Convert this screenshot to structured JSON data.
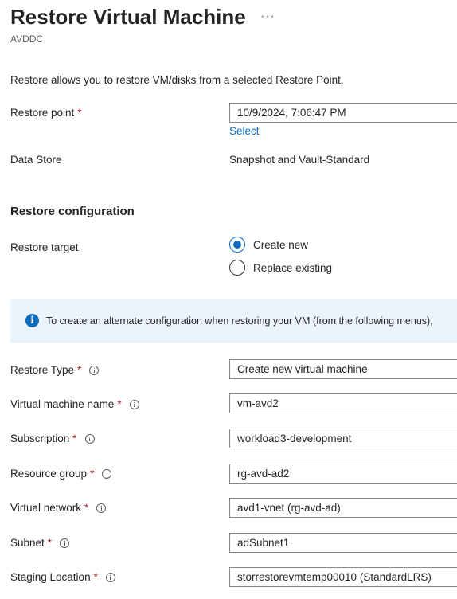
{
  "header": {
    "title": "Restore Virtual Machine",
    "more_label": "···",
    "subtitle": "AVDDC"
  },
  "description": "Restore allows you to restore VM/disks from a selected Restore Point.",
  "restore_point": {
    "label": "Restore point",
    "required": "*",
    "value": "10/9/2024, 7:06:47 PM",
    "select_link": "Select"
  },
  "data_store": {
    "label": "Data Store",
    "value": "Snapshot and Vault-Standard"
  },
  "restore_configuration": {
    "heading": "Restore configuration",
    "target_label": "Restore target",
    "options": [
      {
        "label": "Create new",
        "selected": true
      },
      {
        "label": "Replace existing",
        "selected": false
      }
    ]
  },
  "banner": {
    "icon": "info-icon",
    "text": "To create an alternate configuration when restoring your VM (from the following menus),"
  },
  "fields": [
    {
      "label": "Restore Type",
      "required": "*",
      "value": "Create new virtual machine"
    },
    {
      "label": "Virtual machine name",
      "required": "*",
      "value": "vm-avd2"
    },
    {
      "label": "Subscription",
      "required": "*",
      "value": "workload3-development"
    },
    {
      "label": "Resource group",
      "required": "*",
      "value": "rg-avd-ad2"
    },
    {
      "label": "Virtual network",
      "required": "*",
      "value": "avd1-vnet (rg-avd-ad)"
    },
    {
      "label": "Subnet",
      "required": "*",
      "value": "adSubnet1"
    },
    {
      "label": "Staging Location",
      "required": "*",
      "value": "storrestorevmtemp00010 (StandardLRS)"
    }
  ],
  "colors": {
    "accent": "#0f6cbd",
    "required": "#a4262c",
    "banner_bg": "#ebf3fc"
  }
}
